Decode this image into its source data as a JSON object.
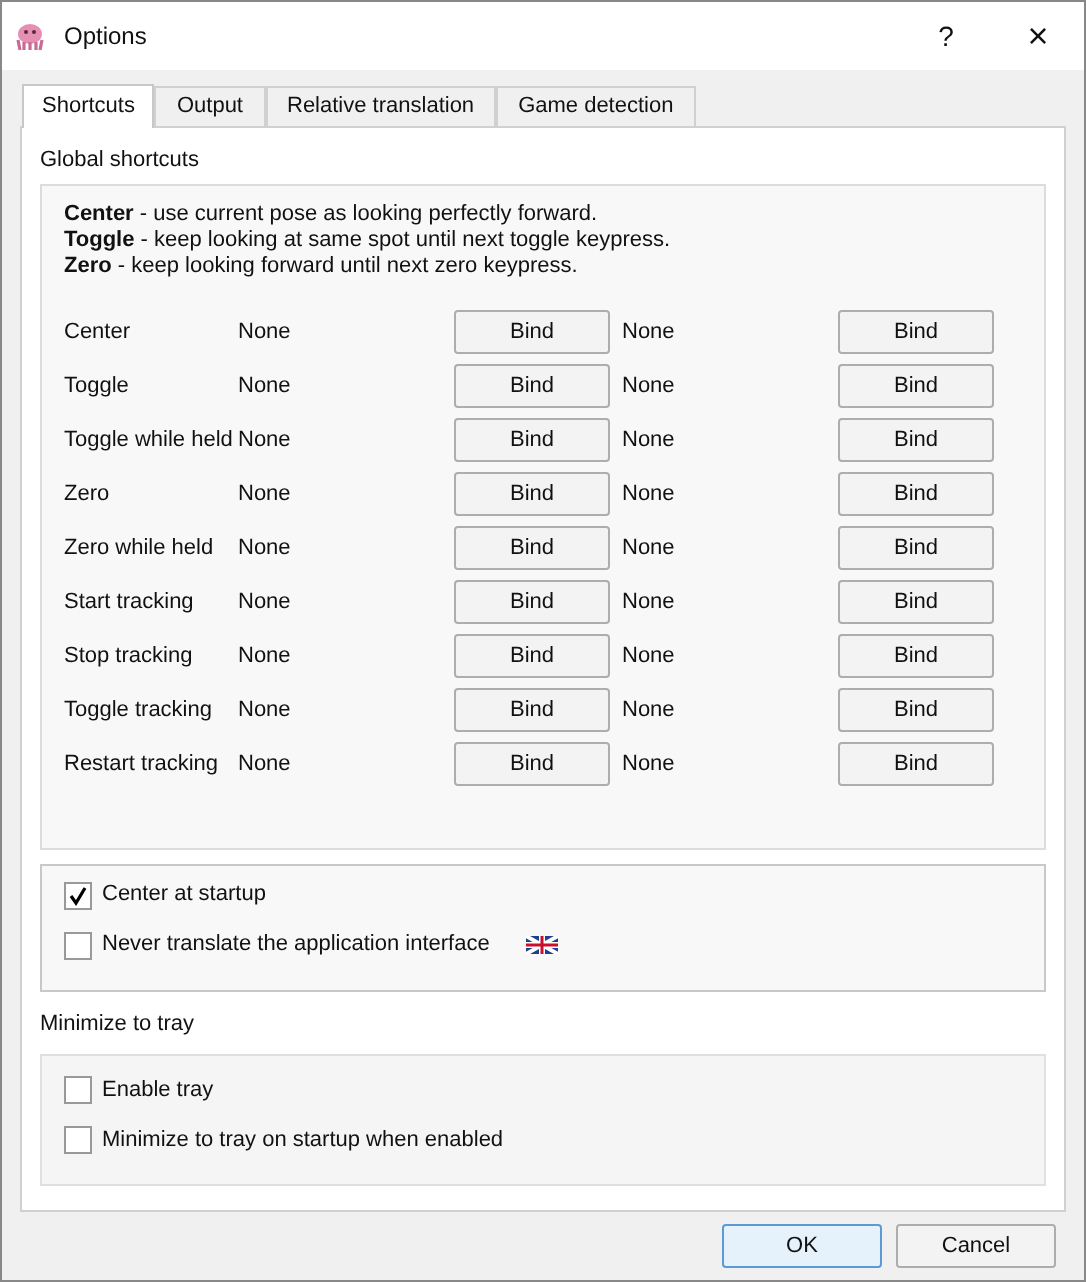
{
  "window": {
    "title": "Options",
    "help_button": "?",
    "close_button": "×"
  },
  "tabs": [
    {
      "label": "Shortcuts",
      "selected": true
    },
    {
      "label": "Output",
      "selected": false
    },
    {
      "label": "Relative translation",
      "selected": false
    },
    {
      "label": "Game detection",
      "selected": false
    }
  ],
  "global_shortcuts": {
    "title": "Global shortcuts",
    "description": [
      "**Center** - use current pose as looking perfectly forward.",
      "**Toggle** - keep looking at same spot until next toggle keypress.",
      "**Zero** - keep looking forward until next zero keypress."
    ],
    "rows": [
      {
        "name": "Center",
        "key_1": "None",
        "button_1": "Bind",
        "key_2": "None",
        "button_2": "Bind"
      },
      {
        "name": "Toggle",
        "key_1": "None",
        "button_1": "Bind",
        "key_2": "None",
        "button_2": "Bind"
      },
      {
        "name": "Toggle while held",
        "key_1": "None",
        "button_1": "Bind",
        "key_2": "None",
        "button_2": "Bind"
      },
      {
        "name": "Zero",
        "key_1": "None",
        "button_1": "Bind",
        "key_2": "None",
        "button_2": "Bind"
      },
      {
        "name": "Zero while held",
        "key_1": "None",
        "button_1": "Bind",
        "key_2": "None",
        "button_2": "Bind"
      },
      {
        "name": "Start tracking",
        "key_1": "None",
        "button_1": "Bind",
        "key_2": "None",
        "button_2": "Bind"
      },
      {
        "name": "Stop tracking",
        "key_1": "None",
        "button_1": "Bind",
        "key_2": "None",
        "button_2": "Bind"
      },
      {
        "name": "Toggle tracking",
        "key_1": "None",
        "button_1": "Bind",
        "key_2": "None",
        "button_2": "Bind"
      },
      {
        "name": "Restart tracking",
        "key_1": "None",
        "button_1": "Bind",
        "key_2": "None",
        "button_2": "Bind"
      }
    ]
  },
  "general_options": [
    {
      "label": "Center at startup",
      "checked": true,
      "kind": "plain"
    },
    {
      "label": "Never translate the application interface",
      "checked": false,
      "kind": "language"
    }
  ],
  "minimize_to_tray": {
    "title": "Minimize to tray",
    "options": [
      {
        "label": "Enable tray",
        "checked": false
      },
      {
        "label": "Minimize to tray on startup when enabled",
        "checked": false
      }
    ]
  },
  "buttons": [
    {
      "label": "OK",
      "kind": "default"
    },
    {
      "label": "Cancel",
      "kind": "normal"
    }
  ]
}
